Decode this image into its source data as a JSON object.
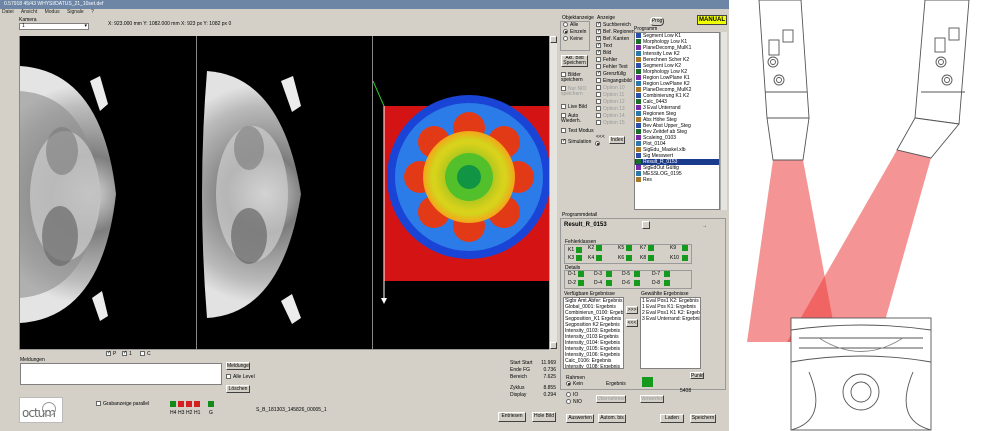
{
  "window": {
    "title": "0.57918 45/43 WHYSI/DATUS_21_10set.def"
  },
  "menu": [
    "Datei",
    "Ansicht",
    "Modus",
    "Signale",
    "?"
  ],
  "camera": {
    "label": "Kamera",
    "value": "1"
  },
  "coords_text": "X: 923.000 mm  Y: 1082.000 mm  X: 923 px  Y: 1082 px    0",
  "view_mode": {
    "title": "Objektanzeige",
    "options": [
      {
        "label": "Alle",
        "on": false
      },
      {
        "label": "Einzeln",
        "on": true
      },
      {
        "label": "Keine",
        "on": false
      }
    ]
  },
  "mid_controls": {
    "save_ref": "Akt. Bild Speichern",
    "bilder_speichern": "Bilder speichern",
    "nio_speichern": "Nur NIO speichern",
    "live_bild": "Live Bild",
    "auto_wiederh": "Auto Wiederh.",
    "test_modus": "Test Modus",
    "simulation": "Simulation",
    "index": "Index"
  },
  "display": {
    "title": "Anzeige",
    "items": [
      {
        "label": "Suchbereich",
        "on": true,
        "dis": false
      },
      {
        "label": "Bef. Regionen",
        "on": true,
        "dis": false
      },
      {
        "label": "Bef. Kanten",
        "on": true,
        "dis": false
      },
      {
        "label": "Text",
        "on": true,
        "dis": false
      },
      {
        "label": "Bild",
        "on": true,
        "dis": false
      },
      {
        "label": "Fehler",
        "on": false,
        "dis": false
      },
      {
        "label": "Fehler Text",
        "on": false,
        "dis": false
      },
      {
        "label": "Grenzfüllg",
        "on": true,
        "dis": false
      },
      {
        "label": "Eingangsbild",
        "on": false,
        "dis": false
      },
      {
        "label": "Option 10",
        "on": false,
        "dis": true
      },
      {
        "label": "Option 11",
        "on": false,
        "dis": true
      },
      {
        "label": "Option 12",
        "on": false,
        "dis": true
      },
      {
        "label": "Option 13",
        "on": false,
        "dis": true
      },
      {
        "label": "Option 14",
        "on": false,
        "dis": true
      },
      {
        "label": "Option 15",
        "on": false,
        "dis": true
      }
    ]
  },
  "prog_button": "Prog",
  "manual_badge": "MANUAL",
  "programs": {
    "label": "Programm",
    "items": [
      "Segment Low K1",
      "Morphology Low K1",
      "PlaneDecomp_MulK1",
      "Intensity Low K2",
      "Berechnen Scher K2",
      "Segment Low K2",
      "Morphology Low K2",
      "Region LowPlane K1",
      "Region LowPlane K2",
      "PlaneDecomp_MulK2",
      "Combinierung K1 K2",
      "Calc_0443",
      "3 Eval Unterrand",
      "Regionen Steg",
      "Abs Höhe Steg",
      "Bev Abst Upper_Steg",
      "Bev Zeitdef ab Steg",
      "Scaleing_0103",
      "Plot_0104",
      "SigEdu_Maskel.xlb",
      "Sig Messwert",
      "Result_R_0153",
      "SigEdOut Gültig",
      "MESSLOG_0195",
      "Res"
    ],
    "selected": 21
  },
  "prog_detail": {
    "title": "Programmdetail",
    "name": "Result_R_0153",
    "fehler_title": "Fehlerklassen",
    "fehler": [
      "K1",
      "K2",
      "K3",
      "K4",
      "K5",
      "K6",
      "K7",
      "K8",
      "K9",
      "K10"
    ],
    "details_title": "Details",
    "details": [
      "D-1",
      "D-2",
      "D-3",
      "D-4",
      "D-5",
      "D-6",
      "D-7",
      "D-8"
    ]
  },
  "available_results": {
    "title": "Verfügbare Ergebnisse",
    "items": [
      "Sigbr Amt.Abfer: Ergebnis",
      "Global_0001: Ergebnis",
      "Combinierun_0100: Ergebnis",
      "Segposition_K1 Ergebnis",
      "Segposition K2 Ergebnis",
      "Intensity_0103: Ergebnis",
      "Intensity_0103 Ergebnis",
      "Intensity_0104: Ergebnis",
      "Intensity_0105: Ergebnis",
      "Intensity_0106: Ergebnis",
      "Calc_0106: Ergebnis",
      "Intensity_0108: Ergebnis",
      "Intensity_0110: Ergebnis",
      "Intensity_0109: Ergebnis",
      "Calc_0106: Ergebnis",
      "Berechnen Pos1 K2: Ergebnis"
    ]
  },
  "selected_results": {
    "title": "Gewählte Ergebnisse",
    "items": [
      "1 Eval Pos1 K2: Ergebnis",
      "1 Eval Pos K1: Ergebnis",
      "2 Eval Pos1 K1 K2: Ergebnis",
      "3 Eval Unterrand: Ergebnis"
    ]
  },
  "move_right": ">>>",
  "move_left": "<<<",
  "punkt_button": "Punkt",
  "bottom_radios": {
    "title": "Rahmen",
    "options": [
      {
        "label": "Kein",
        "on": true
      },
      {
        "label": "IO",
        "on": false
      },
      {
        "label": "NIO",
        "on": false
      }
    ]
  },
  "ergebnis_label": "Ergebnis",
  "value_5408": "5408",
  "dim_buttons": [
    "Übernehmen",
    "Verwerfen"
  ],
  "messages": {
    "title": "Meldungen",
    "flags": [
      "P",
      "1",
      "C"
    ],
    "btn_messages": "Meldungen",
    "btn_all": "Alle Level",
    "btn_clear": "Löschen"
  },
  "stats": [
    {
      "label": "Start Start",
      "value": "11.969"
    },
    {
      "label": "Ende FG",
      "value": "0.736"
    },
    {
      "label": "Bereich",
      "value": "7.625"
    },
    {
      "label": "Zyklus",
      "value": "8.855"
    },
    {
      "label": "Display",
      "value": "0.294"
    }
  ],
  "logo_text": "octum",
  "grabber_parallel": "Grabanzeige parallel",
  "indicators": {
    "labels": [
      "H4",
      "H3",
      "H2",
      "H1",
      "G"
    ],
    "colors": [
      "#138a1c",
      "#d42020",
      "#d42020",
      "#d42020",
      "#138a1c"
    ]
  },
  "status_path": "S_B_181303_145826_00005_1",
  "bottom_buttons": {
    "entriesen": "Entriesen",
    "hole_bild": "Hole Bild",
    "auswerten": "Auswerten",
    "autom_bis": "Autom. bis",
    "laden": "Laden",
    "speichern": "Speichern"
  },
  "colors": {
    "app_bg": "#d4d0c8",
    "manual": "#f0ff00",
    "red_zone": "#d41414",
    "beam": "#ec3c3c",
    "selected": "#1a3b8b"
  }
}
